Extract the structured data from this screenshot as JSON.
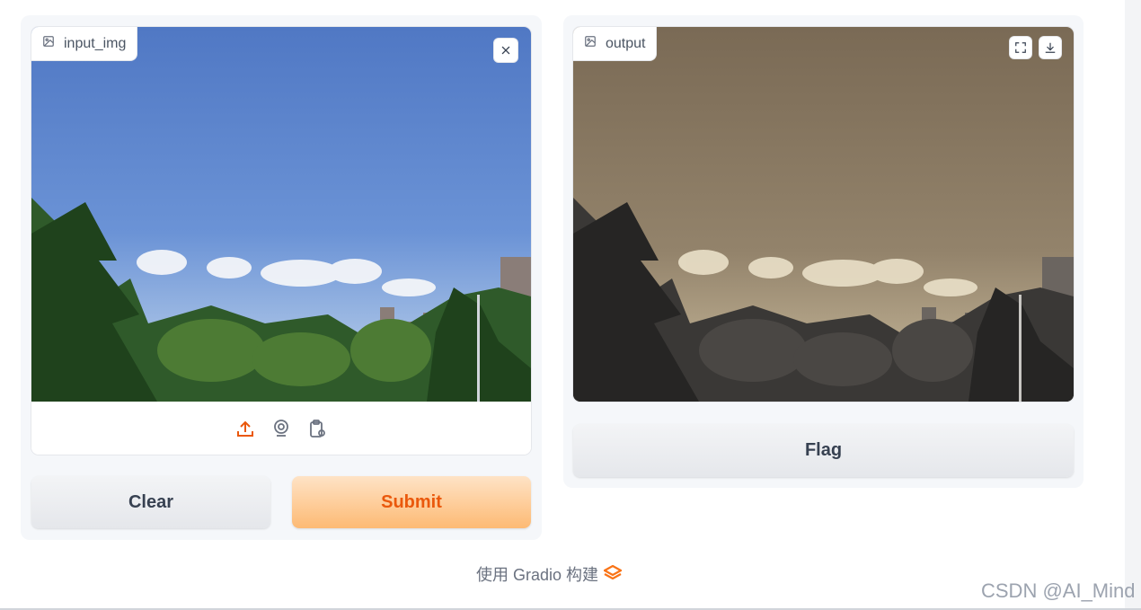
{
  "input_panel": {
    "label": "input_img",
    "source_icons": [
      "upload-icon",
      "webcam-icon",
      "clipboard-icon"
    ],
    "clear_icon": "close-icon"
  },
  "output_panel": {
    "label": "output",
    "action_icons": [
      "fullscreen-icon",
      "download-icon"
    ]
  },
  "buttons": {
    "clear_label": "Clear",
    "submit_label": "Submit",
    "flag_label": "Flag"
  },
  "footer": {
    "text": "使用 Gradio 构建",
    "logo_icon": "gradio-logo-icon"
  },
  "watermark": "CSDN @AI_Mind",
  "colors": {
    "accent": "#ea580c",
    "primary_gradient_top": "#fee3c6",
    "primary_gradient_bottom": "#fdba74"
  }
}
